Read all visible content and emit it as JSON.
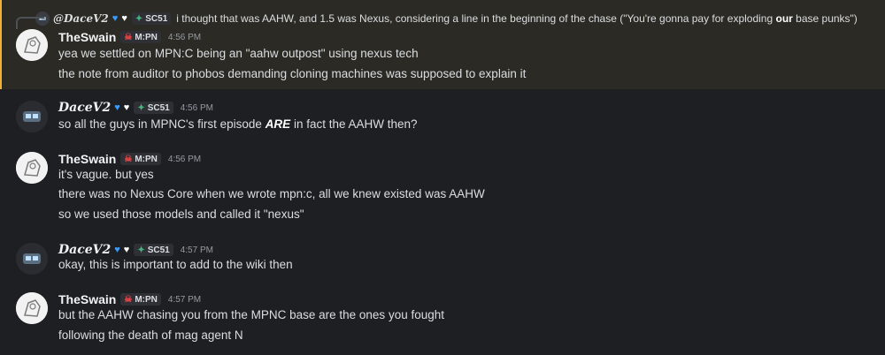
{
  "reply": {
    "author": "@DaceV2",
    "tag": "SC51",
    "text_before": "i thought that was AAHW, and 1.5 was Nexus, considering a line in the beginning of the chase (\"You're gonna pay for exploding ",
    "text_bold": "our",
    "text_after": " base punks\")"
  },
  "messages": [
    {
      "author": "TheSwain",
      "tag": "M:PN",
      "time": "4:56 PM",
      "lines": [
        "yea we settled on MPN:C being an \"aahw outpost\" using nexus tech",
        "the note from auditor to phobos demanding cloning machines was supposed to explain it"
      ]
    },
    {
      "author": "DaceV2",
      "tag": "SC51",
      "time": "4:56 PM",
      "line_before": "so all the guys in MPNC's first episode ",
      "line_bold": "ARE",
      "line_after": " in fact the AAHW then?"
    },
    {
      "author": "TheSwain",
      "tag": "M:PN",
      "time": "4:56 PM",
      "lines": [
        "it's vague. but yes",
        "there was no Nexus Core when we wrote mpn:c, all we knew existed was AAHW",
        "so we used those models and called it \"nexus\""
      ]
    },
    {
      "author": "DaceV2",
      "tag": "SC51",
      "time": "4:57 PM",
      "lines": [
        "okay, this is important to add to the wiki then"
      ]
    },
    {
      "author": "TheSwain",
      "tag": "M:PN",
      "time": "4:57 PM",
      "lines": [
        "but the AAHW chasing you from the MPNC base are the ones you fought",
        "following the death of mag agent N"
      ]
    }
  ],
  "icons": {
    "heart_blue": "#3b9cff",
    "heart_white": "#ffffff",
    "mpn_tag_icon": "skull-icon",
    "sc51_tag_icon": "plus-star-icon"
  },
  "colors": {
    "highlight": "#2b2a24",
    "highlight_bar": "#f0b232",
    "background": "#1e1f22"
  }
}
